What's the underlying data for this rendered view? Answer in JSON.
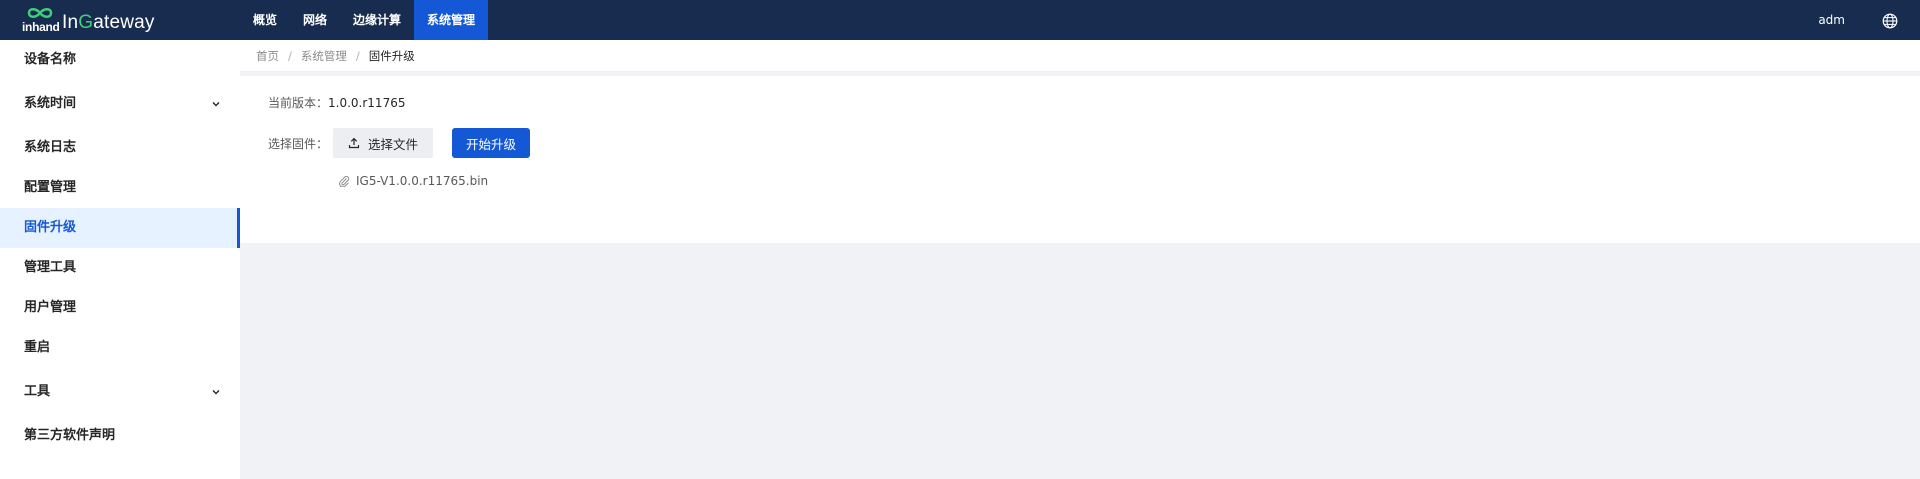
{
  "app": {
    "logo_prefix": "inhand",
    "logo_name_a": "In",
    "logo_name_g": "G",
    "logo_name_b": "ateway"
  },
  "top_nav": [
    {
      "label": "概览",
      "active": false
    },
    {
      "label": "网络",
      "active": false
    },
    {
      "label": "边缘计算",
      "active": false
    },
    {
      "label": "系统管理",
      "active": true
    }
  ],
  "user": {
    "name": "adm",
    "language_icon": "globe-icon"
  },
  "sidebar": {
    "items": [
      {
        "label": "设备名称"
      },
      {
        "label": "系统时间",
        "has_submenu": true
      },
      {
        "label": "系统日志"
      },
      {
        "label": "配置管理"
      },
      {
        "label": "固件升级",
        "active": true
      },
      {
        "label": "管理工具"
      },
      {
        "label": "用户管理"
      },
      {
        "label": "重启"
      },
      {
        "label": "工具",
        "has_submenu": true
      },
      {
        "label": "第三方软件声明"
      }
    ]
  },
  "breadcrumb": [
    "首页",
    "系统管理",
    "固件升级"
  ],
  "firmware": {
    "current_version_label": "当前版本：",
    "current_version": "1.0.0.r11765",
    "select_label": "选择固件：",
    "select_button": "选择文件",
    "start_button": "开始升级",
    "selected_file": "IG5-V1.0.0.r11765.bin"
  },
  "colors": {
    "topbar": "#172c4e",
    "accent": "#1558d6",
    "logo_g": "#3fd07a",
    "background": "#f0f2f5"
  }
}
